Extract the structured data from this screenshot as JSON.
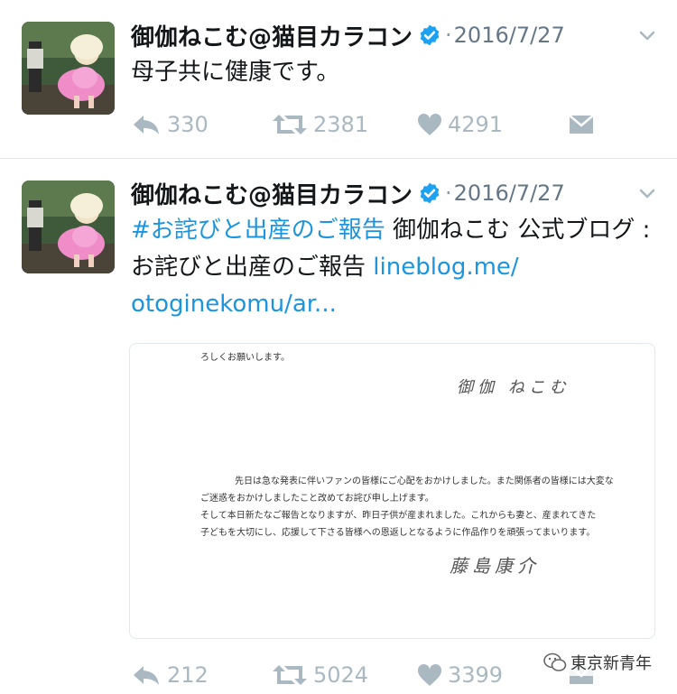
{
  "tweets": [
    {
      "author": "御伽ねこむ@猫目カラコン",
      "separator": "·",
      "date": "2016/7/27",
      "text": "母子共に健康です。",
      "stats": {
        "replies": "330",
        "retweets": "2381",
        "likes": "4291"
      }
    },
    {
      "author": "御伽ねこむ@猫目カラコン",
      "separator": "·",
      "date": "2016/7/27",
      "hashtag": "#お詫びと出産のご報告",
      "text_middle": " 御伽ねこむ 公式ブログ : お詫びと出産のご報告 ",
      "link_part1": "lineblog.me/",
      "link_part2": "otoginekomu/ar...",
      "stats": {
        "replies": "212",
        "retweets": "5024",
        "likes": "3399"
      },
      "letter": {
        "top_line": "ろしくお願いします。",
        "signature_top": "御伽 ねこむ",
        "para_line1": "先日は急な発表に伴いファンの皆様にご心配をおかけしました。また関係者の皆様には大変な",
        "para_line2": "ご迷惑をおかけしましたこと改めてお詫び申し上げます。",
        "para_line3": "そして本日新たなご報告となりますが、昨日子供が産まれました。これからも妻と、産まれてきた",
        "para_line4": "子どもを大切にし、応援して下さる皆様への恩返しとなるように作品作りを頑張ってまいります。",
        "signature_bottom": "藤島康介"
      }
    }
  ],
  "watermark": "東京新青年",
  "icons": {
    "verified": "verified-badge-icon",
    "caret": "chevron-down-icon",
    "reply": "reply-icon",
    "retweet": "retweet-icon",
    "like": "heart-icon",
    "dm": "envelope-icon"
  },
  "colors": {
    "link": "#1b95e0",
    "verified": "#1da1f2",
    "icon": "#aab8c2",
    "muted": "#657786"
  }
}
